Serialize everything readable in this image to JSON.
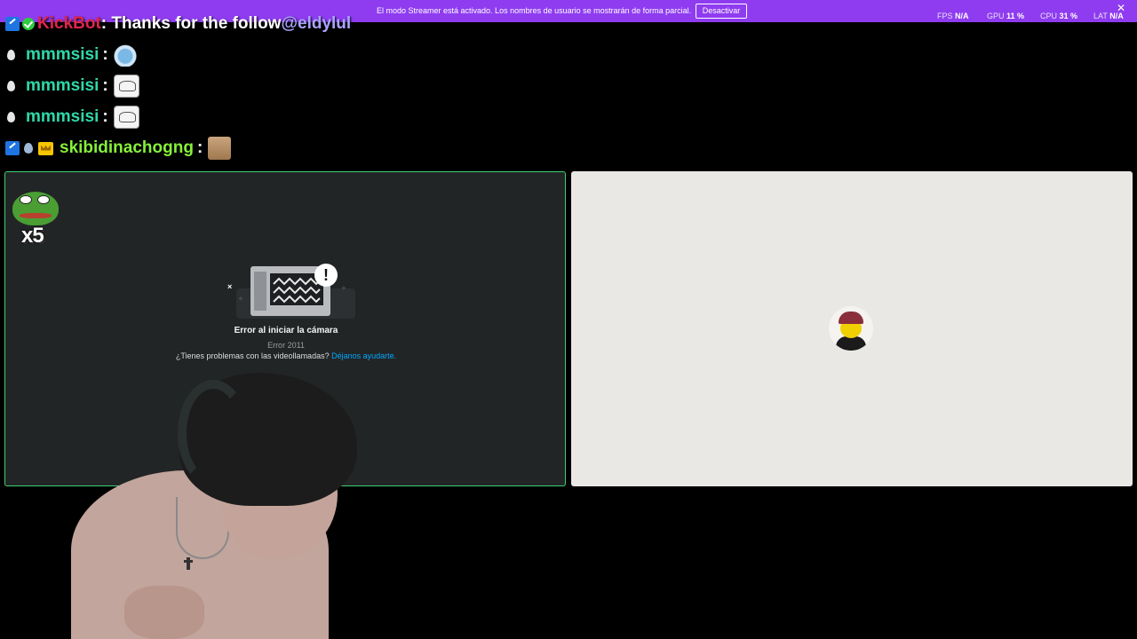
{
  "banner": {
    "text": "El modo Streamer está activado. Los nombres de usuario se mostrarán de forma parcial.",
    "button_label": "Desactivar",
    "close_glyph": "✕",
    "background_color": "#8f3cf0"
  },
  "stats": {
    "fps_label": "FPS",
    "fps_value": "N/A",
    "gpu_label": "GPU",
    "gpu_value": "11 %",
    "cpu_label": "CPU",
    "cpu_value": "31 %",
    "lat_label": "LAT",
    "lat_value": "N/A"
  },
  "chat": {
    "messages": [
      {
        "username": "KickBot",
        "text": ": Thanks for the follow ",
        "mention": "@eldylul",
        "badges": [
          "verified-icon",
          "check-icon"
        ]
      },
      {
        "username": "mmmsisi",
        "separator": ":",
        "emote": "crying-face-emote",
        "badges": [
          "drop-icon"
        ]
      },
      {
        "username": "mmmsisi",
        "separator": ":",
        "emote": "sketch-emote",
        "badges": [
          "drop-icon"
        ]
      },
      {
        "username": "mmmsisi",
        "separator": ":",
        "emote": "sketch-emote",
        "badges": [
          "drop-icon"
        ]
      },
      {
        "username": "skibidinachogng",
        "separator": ":",
        "emote": "cat-emote",
        "badges": [
          "verified-icon",
          "drop-icon",
          "crown-icon"
        ]
      }
    ],
    "colors": {
      "kickbot": "#e0254b",
      "mmmsisi": "#2fd8a8",
      "skibidi": "#86f03a",
      "mention": "#a9a4ff"
    }
  },
  "call": {
    "overlay_count": "x5",
    "error_title": "Error al iniciar la cámara",
    "error_code": "Error 2011",
    "help_text": "¿Tienes problemas con las videollamadas?",
    "help_link": "Déjanos ayudarte.",
    "alert_glyph": "!",
    "close_glyph": "×",
    "active_border_color": "#3fcf70",
    "right_panel_color": "#e9e8e4"
  }
}
